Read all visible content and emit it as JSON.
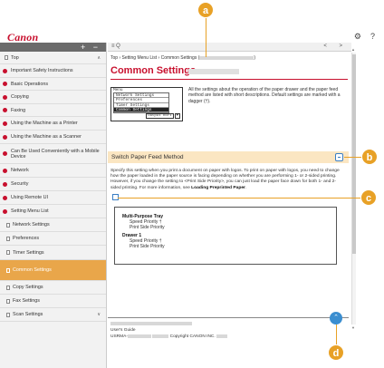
{
  "header": {
    "logo": "Canon",
    "settings_icon": "gear-icon",
    "help_label": "?"
  },
  "sidebar": {
    "controls": "+ −",
    "items": [
      {
        "label": "Top",
        "kind": "page"
      },
      {
        "label": "Important Safety Instructions",
        "kind": "chapter"
      },
      {
        "label": "Basic Operations",
        "kind": "chapter"
      },
      {
        "label": "Copying",
        "kind": "chapter"
      },
      {
        "label": "Faxing",
        "kind": "chapter"
      },
      {
        "label": "Using the Machine as a Printer",
        "kind": "chapter"
      },
      {
        "label": "Using the Machine as a Scanner",
        "kind": "chapter"
      },
      {
        "label": "Can Be Used Conveniently with a Mobile Device",
        "kind": "chapter"
      },
      {
        "label": "Network",
        "kind": "chapter"
      },
      {
        "label": "Security",
        "kind": "chapter"
      },
      {
        "label": "Using Remote UI",
        "kind": "chapter"
      },
      {
        "label": "Setting Menu List",
        "kind": "chapter"
      },
      {
        "label": "Network Settings",
        "kind": "page"
      },
      {
        "label": "Preferences",
        "kind": "page"
      },
      {
        "label": "Timer Settings",
        "kind": "page"
      },
      {
        "label": "Common Settings",
        "kind": "page",
        "active": true
      },
      {
        "label": "Copy Settings",
        "kind": "page"
      },
      {
        "label": "Fax Settings",
        "kind": "page"
      },
      {
        "label": "Scan Settings",
        "kind": "page"
      }
    ]
  },
  "toolbar": {
    "left": "≡ Q",
    "right": "< >"
  },
  "breadcrumb": "Top › Setting Menu List › Common Settings (",
  "page": {
    "title": "Common Settings",
    "intro": "All the settings about the operation of the paper drawer and the paper feed method are listed with short descriptions. Default settings are marked with a dagger (†).",
    "menu_lines": [
      "Menu",
      "Network Settings",
      "Preferences",
      "Timer Settings",
      "Common Settings"
    ],
    "menu_buttons": [
      "Output Rort",
      "▼"
    ],
    "section_title": "Switch Paper Feed Method",
    "para_parts": [
      "Specify this setting when you print a document on paper with logos. To print on paper with logos, you need to change how the paper loaded in the paper source is facing depending on whether you are performing 1- or 2-sided printing. However, if you change the setting to <Print Side Priority>, you can just load the paper face down for both 1- and 2-sided printing. For more information, see ",
      "Loading Preprinted Paper",
      "."
    ],
    "settings": [
      {
        "heading": "Multi-Purpose Tray",
        "values": [
          "Speed Priority †",
          "Print Side Priority"
        ]
      },
      {
        "heading": "Drawer 1",
        "values": [
          "Speed Priority †",
          "Print Side Priority"
        ]
      }
    ]
  },
  "footer": {
    "guide": "User's Guide",
    "prefix": "USRMA-",
    "copyright": "Copyright CANON INC."
  },
  "callouts": [
    "a",
    "b",
    "c",
    "d"
  ],
  "colors": {
    "brand": "#c8102e",
    "callout": "#e8a126",
    "active": "#e9a64a",
    "section": "#fbe6c2",
    "top_button": "#3b8ed0"
  }
}
